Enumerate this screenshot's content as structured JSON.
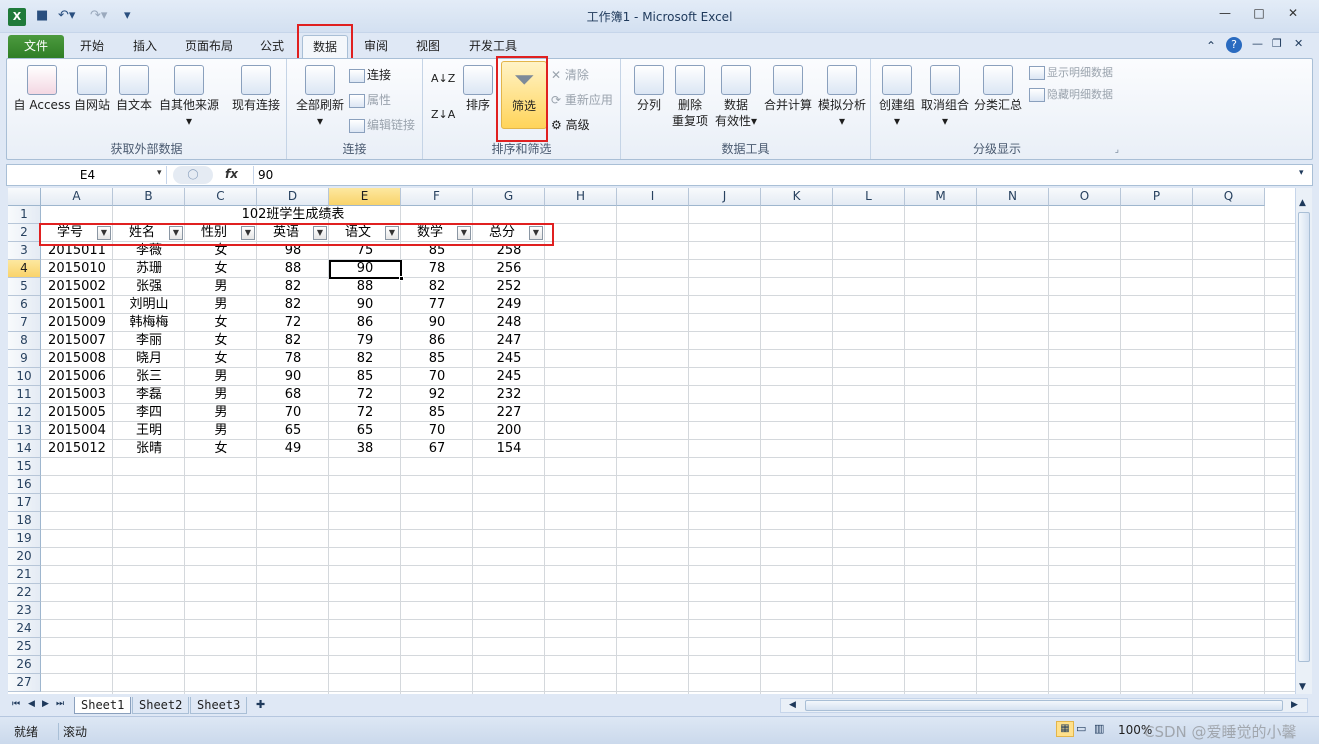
{
  "window": {
    "title": "工作簿1 - Microsoft Excel"
  },
  "tabs": [
    "文件",
    "开始",
    "插入",
    "页面布局",
    "公式",
    "数据",
    "审阅",
    "视图",
    "开发工具"
  ],
  "ribbon": {
    "get_external": {
      "label": "获取外部数据",
      "access": "自 Access",
      "web": "自网站",
      "text": "自文本",
      "other": "自其他来源",
      "existing": "现有连接"
    },
    "connections": {
      "label": "连接",
      "refresh": "全部刷新",
      "connections": "连接",
      "properties": "属性",
      "edit_links": "编辑链接"
    },
    "sort_filter": {
      "label": "排序和筛选",
      "sort": "排序",
      "filter": "筛选",
      "clear": "清除",
      "reapply": "重新应用",
      "advanced": "高级"
    },
    "data_tools": {
      "label": "数据工具",
      "text_to_columns": "分列",
      "remove_dup_1": "删除",
      "remove_dup_2": "重复项",
      "validation_1": "数据",
      "validation_2": "有效性",
      "consolidate": "合并计算",
      "whatif": "模拟分析"
    },
    "outline": {
      "label": "分级显示",
      "group": "创建组",
      "ungroup": "取消组合",
      "subtotal": "分类汇总",
      "show_detail": "显示明细数据",
      "hide_detail": "隐藏明细数据"
    }
  },
  "formula_bar": {
    "name_box": "E4",
    "fx": "fx",
    "value": "90"
  },
  "sheet": {
    "columns": [
      "A",
      "B",
      "C",
      "D",
      "E",
      "F",
      "G",
      "H",
      "I",
      "J",
      "K",
      "L",
      "M",
      "N",
      "O",
      "P",
      "Q"
    ],
    "selected_cell": "E4",
    "title": "102班学生成绩表",
    "headers": [
      "学号",
      "姓名",
      "性别",
      "英语",
      "语文",
      "数学",
      "总分"
    ],
    "rows": [
      [
        "2015011",
        "李薇",
        "女",
        "98",
        "75",
        "85",
        "258"
      ],
      [
        "2015010",
        "苏珊",
        "女",
        "88",
        "90",
        "78",
        "256"
      ],
      [
        "2015002",
        "张强",
        "男",
        "82",
        "88",
        "82",
        "252"
      ],
      [
        "2015001",
        "刘明山",
        "男",
        "82",
        "90",
        "77",
        "249"
      ],
      [
        "2015009",
        "韩梅梅",
        "女",
        "72",
        "86",
        "90",
        "248"
      ],
      [
        "2015007",
        "李丽",
        "女",
        "82",
        "79",
        "86",
        "247"
      ],
      [
        "2015008",
        "晓月",
        "女",
        "78",
        "82",
        "85",
        "245"
      ],
      [
        "2015006",
        "张三",
        "男",
        "90",
        "85",
        "70",
        "245"
      ],
      [
        "2015003",
        "李磊",
        "男",
        "68",
        "72",
        "92",
        "232"
      ],
      [
        "2015005",
        "李四",
        "男",
        "70",
        "72",
        "85",
        "227"
      ],
      [
        "2015004",
        "王明",
        "男",
        "65",
        "65",
        "70",
        "200"
      ],
      [
        "2015012",
        "张晴",
        "女",
        "49",
        "38",
        "67",
        "154"
      ]
    ],
    "row_numbers": [
      "1",
      "2",
      "3",
      "4",
      "5",
      "6",
      "7",
      "8",
      "9",
      "10",
      "11",
      "12",
      "13",
      "14",
      "15",
      "16",
      "17",
      "18",
      "19",
      "20",
      "21",
      "22",
      "23",
      "24",
      "25",
      "26",
      "27"
    ]
  },
  "sheet_tabs": [
    "Sheet1",
    "Sheet2",
    "Sheet3"
  ],
  "status": {
    "ready": "就绪",
    "scroll": "滚动",
    "zoom": "100%",
    "watermark": "CSDN @爱睡觉的小馨"
  }
}
